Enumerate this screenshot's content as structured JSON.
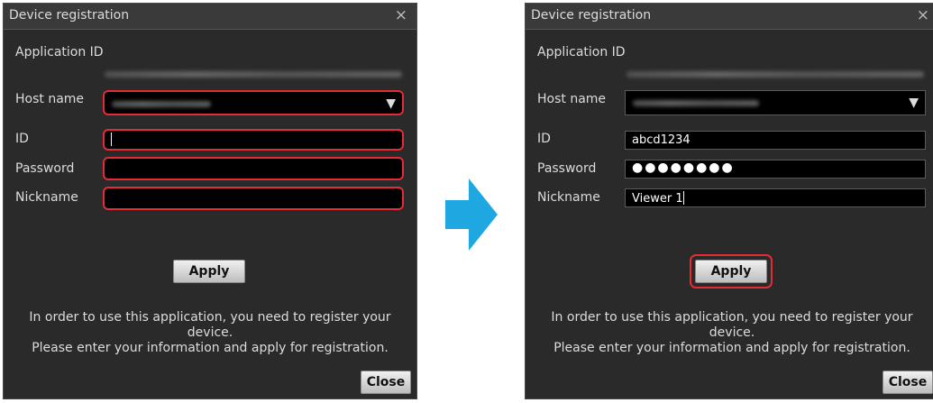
{
  "dialog_before": {
    "title": "Device registration",
    "close_glyph": "×",
    "application_id_label": "Application ID",
    "host_name_label": "Host name",
    "id_label": "ID",
    "password_label": "Password",
    "nickname_label": "Nickname",
    "id_value": "",
    "password_value": "",
    "nickname_value": "",
    "select_arrow": "▼",
    "apply_label": "Apply",
    "info_line1": "In order to use this application, you need to register your",
    "info_line2": "device.",
    "info_line3": "Please enter your information and apply for registration.",
    "close_label": "Close"
  },
  "dialog_after": {
    "title": "Device registration",
    "close_glyph": "×",
    "application_id_label": "Application ID",
    "host_name_label": "Host name",
    "id_label": "ID",
    "password_label": "Password",
    "nickname_label": "Nickname",
    "id_value": "abcd1234",
    "password_value": "●●●●●●●●",
    "nickname_value": "Viewer 1",
    "select_arrow": "▼",
    "apply_label": "Apply",
    "info_line1": "In order to use this application, you need to register your",
    "info_line2": "device.",
    "info_line3": "Please enter your information and apply for registration.",
    "close_label": "Close"
  },
  "colors": {
    "highlight": "#e32c34",
    "arrow": "#1ea7e1",
    "dialog_bg": "#2a2a2a"
  },
  "icons": {
    "transition": "arrow-right-icon",
    "dropdown": "triangle-down-icon",
    "close": "close-icon"
  }
}
